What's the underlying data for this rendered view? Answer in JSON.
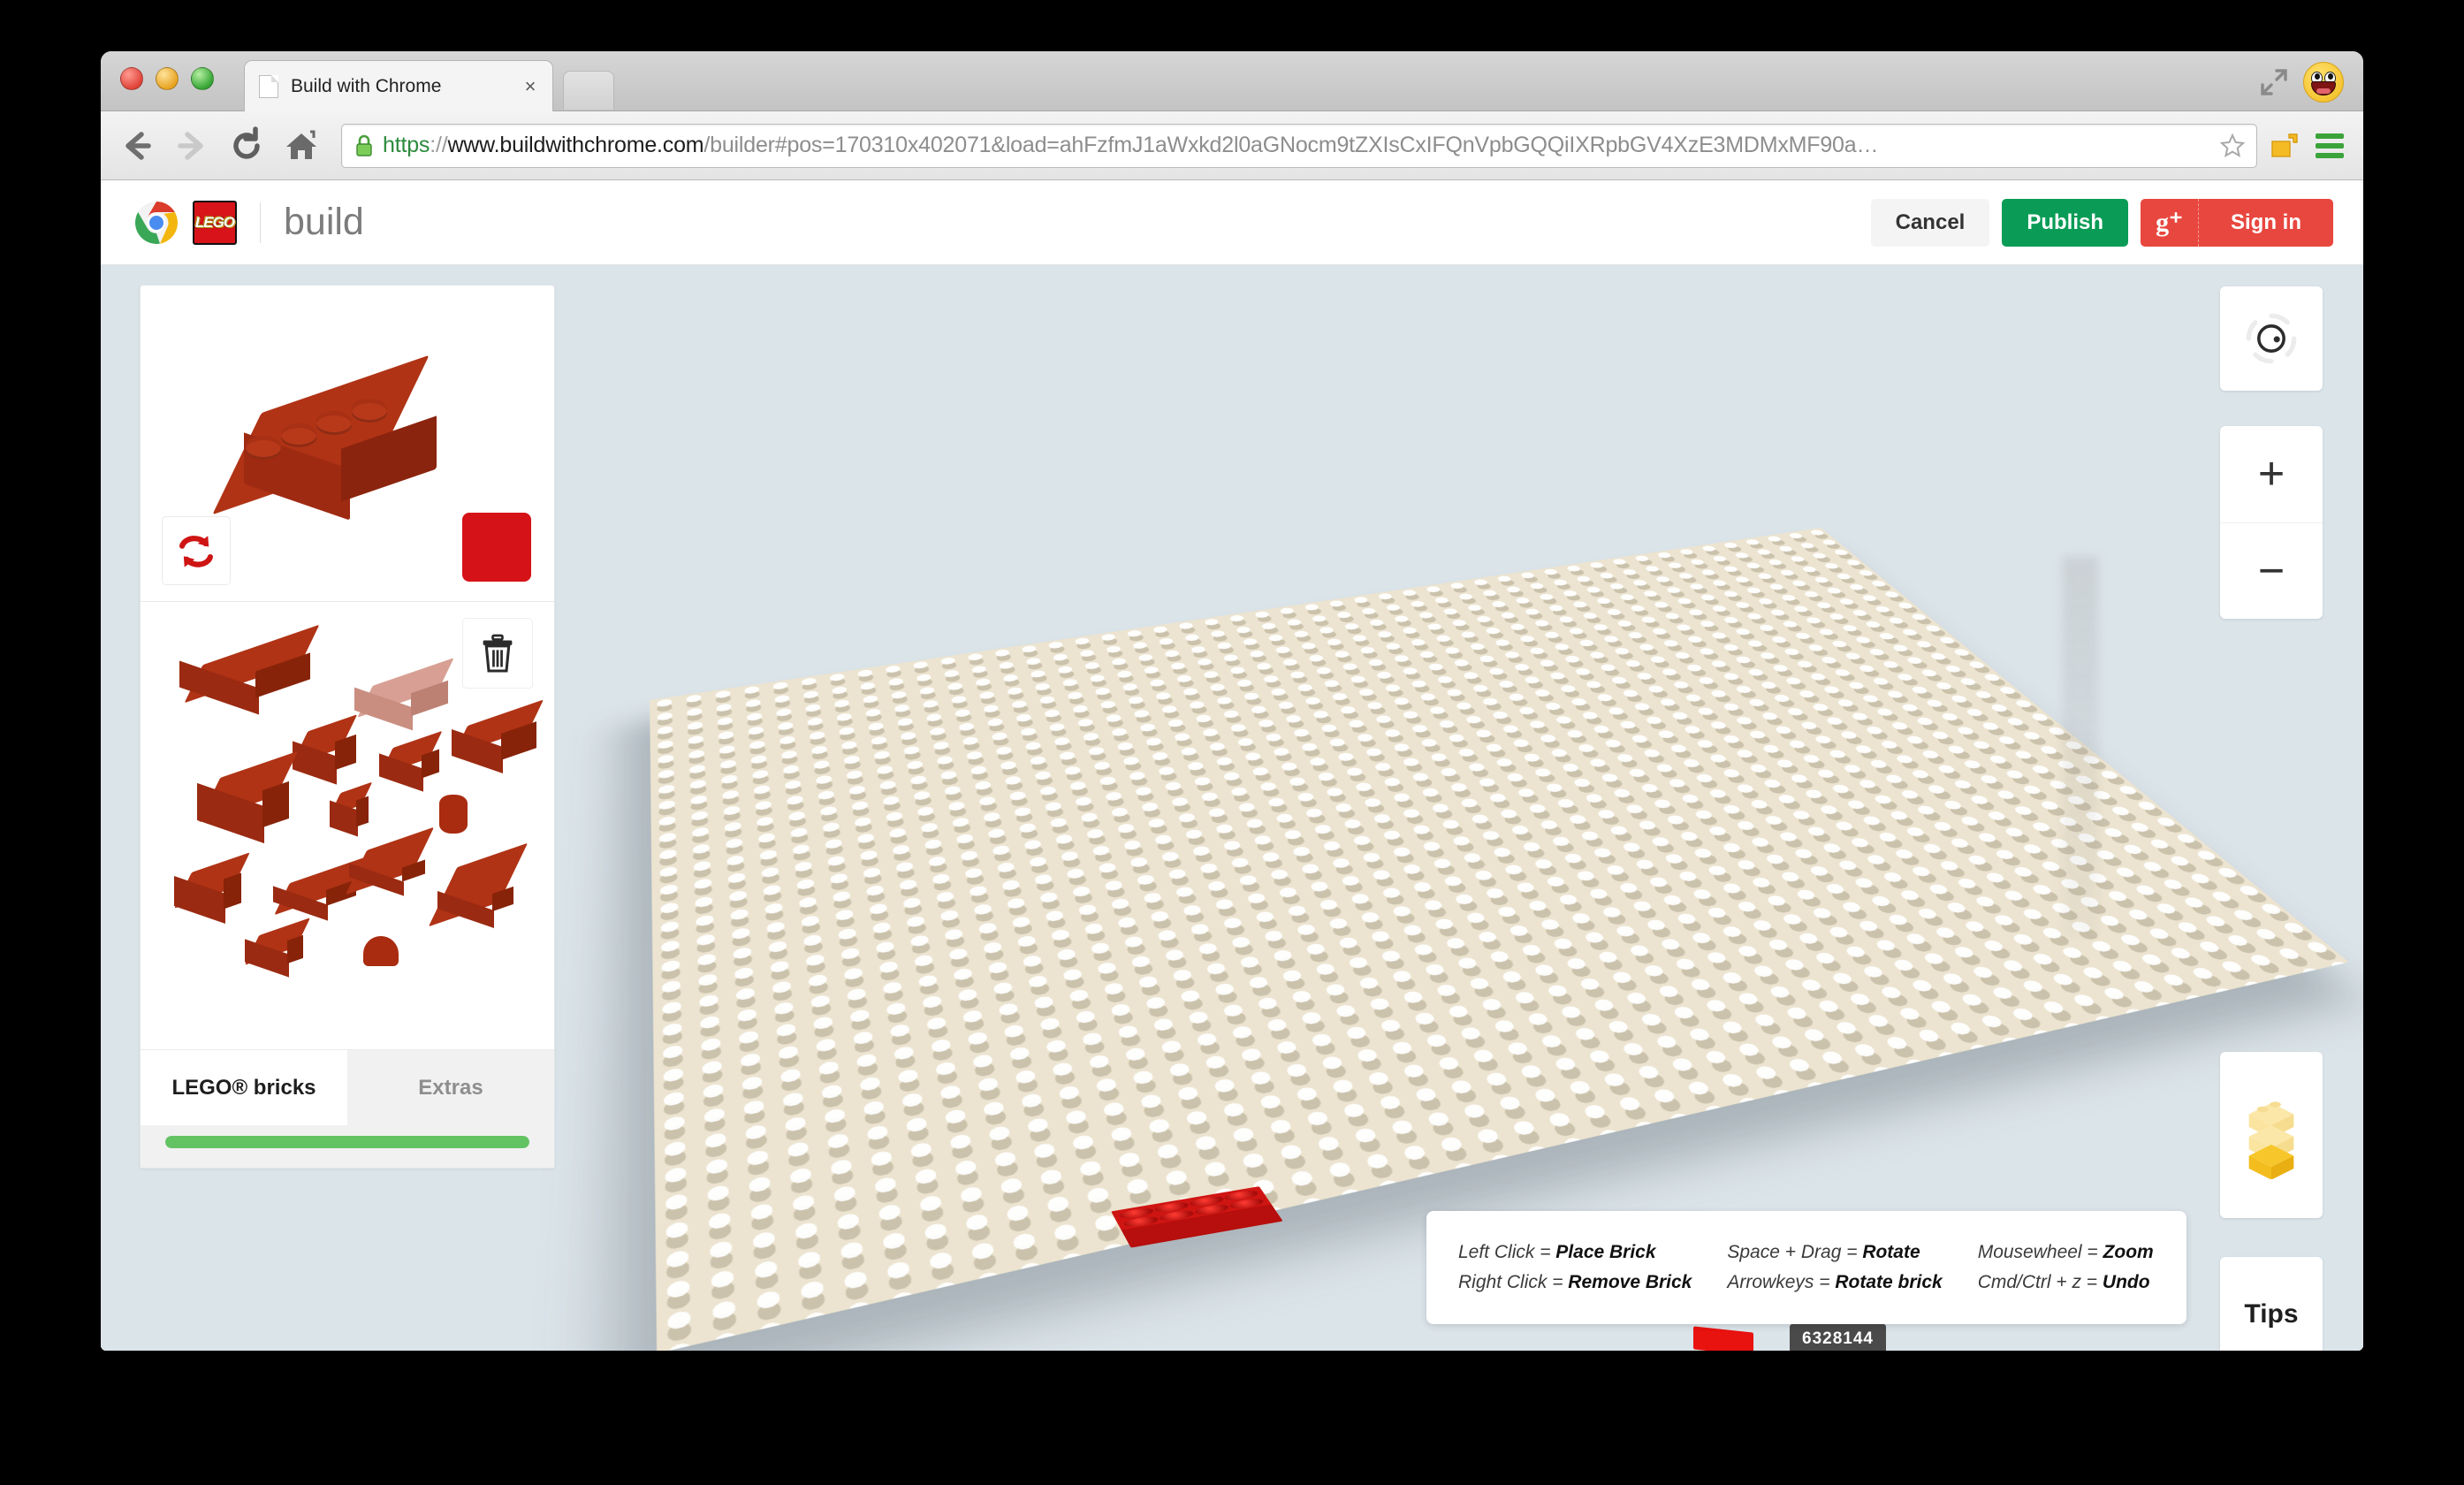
{
  "window": {
    "tab_title": "Build with Chrome",
    "close_label": "×",
    "icons": {
      "favicon": "page-icon",
      "new_tab": "new-tab-icon",
      "fullscreen": "fullscreen-icon",
      "avatar": "awesome-face-avatar"
    }
  },
  "nav": {
    "back": "back-arrow-icon",
    "forward": "forward-arrow-icon",
    "reload": "reload-icon",
    "home": "home-icon",
    "lock": "secure-lock-icon",
    "star": "bookmark-star-icon",
    "extension": "extension-icon",
    "menu": "hamburger-menu-icon",
    "url": {
      "scheme": "https",
      "separator": "://",
      "host": "www.buildwithchrome.com",
      "path": "/builder#pos=170310x402071&load=ahFzfmJ1aWxkd2l0aGNocm9tZXIsCxIFQnVpbGQQiIXRpbGV4XzE3MDMxMF90a…",
      "truncation": "…"
    }
  },
  "site_header": {
    "chrome_logo": "chrome-logo",
    "lego_logo_text": "LEGO",
    "brand_word": "build",
    "cancel_label": "Cancel",
    "publish_label": "Publish",
    "gplus_symbol": "g⁺",
    "signin_label": "Sign in"
  },
  "left_panel": {
    "preview": {
      "brick_name": "2x4-brick-preview",
      "rotate_icon": "rotate-brick-icon",
      "color_swatch_hex": "#d51217"
    },
    "palette": {
      "delete_icon": "trash-icon",
      "piece_count": 17
    },
    "tabs": [
      {
        "label": "LEGO® bricks",
        "active": true
      },
      {
        "label": "Extras",
        "active": false
      }
    ],
    "progress": {
      "percent": 100,
      "fill_hex": "#63c363"
    }
  },
  "canvas": {
    "background_hex": "#dbe4e9",
    "baseplate_hex": "#ece4d0",
    "placed_bricks": [
      {
        "name": "red-brick-left",
        "color_hex": "#cf1512",
        "size": "2x4"
      },
      {
        "name": "red-brick-right",
        "color_hex": "#e01b18",
        "size": "2x4"
      }
    ]
  },
  "side_controls": {
    "orbit_icon": "orbit-camera-icon",
    "zoom_in_label": "+",
    "zoom_out_label": "−",
    "layers_icon": "brick-layers-icon",
    "tips_label": "Tips"
  },
  "tips_overlay": {
    "columns": [
      [
        {
          "key": "Left Click = ",
          "action": "Place Brick"
        },
        {
          "key": "Right Click = ",
          "action": "Remove Brick"
        }
      ],
      [
        {
          "key": "Space + Drag = ",
          "action": "Rotate"
        },
        {
          "key": "Arrowkeys = ",
          "action": "Rotate brick"
        }
      ],
      [
        {
          "key": "Mousewheel = ",
          "action": "Zoom"
        },
        {
          "key": "Cmd/Ctrl + z = ",
          "action": "Undo"
        }
      ]
    ]
  },
  "build_counter": "6328144"
}
